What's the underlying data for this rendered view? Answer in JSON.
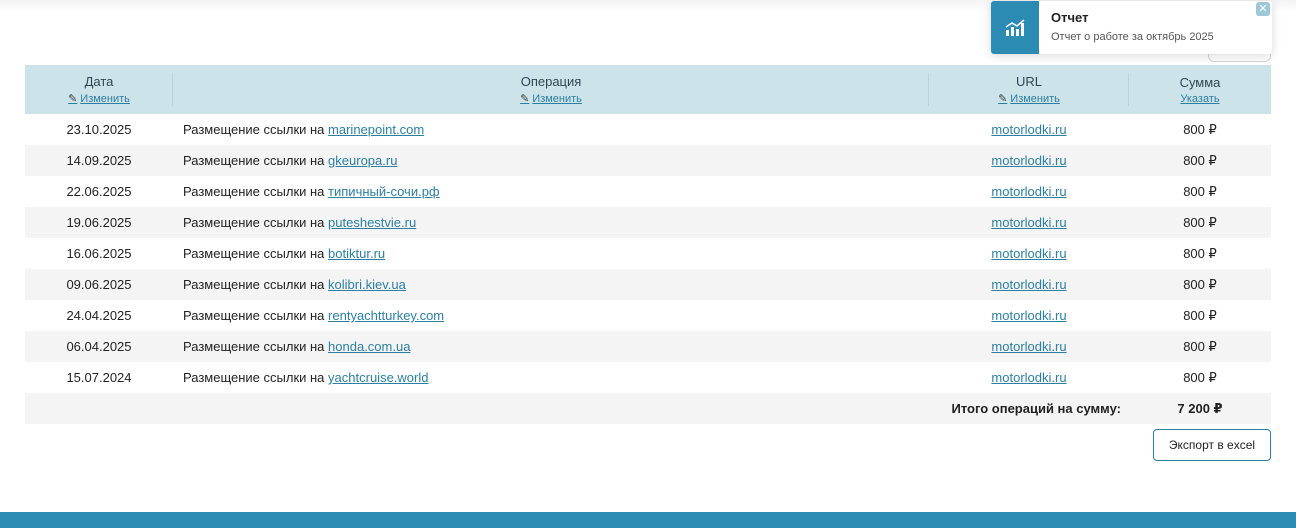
{
  "notification": {
    "title": "Отчет",
    "text": "Отчет о работе за октябрь 2025",
    "close": "✕"
  },
  "table": {
    "headers": {
      "date": "Дата",
      "operation": "Операция",
      "url": "URL",
      "sum": "Сумма",
      "date_edit": "Изменить",
      "operation_edit": "Изменить",
      "url_edit": "Изменить",
      "sum_edit": "Указать"
    },
    "op_prefix": "Размещение ссылки на",
    "rows": [
      {
        "date": "23.10.2025",
        "site": "marinepoint.com",
        "url": "motorlodki.ru",
        "sum": "800 ₽"
      },
      {
        "date": "14.09.2025",
        "site": "gkeuropa.ru",
        "url": "motorlodki.ru",
        "sum": "800 ₽"
      },
      {
        "date": "22.06.2025",
        "site": "типичный-сочи.рф",
        "url": "motorlodki.ru",
        "sum": "800 ₽"
      },
      {
        "date": "19.06.2025",
        "site": "puteshestvie.ru",
        "url": "motorlodki.ru",
        "sum": "800 ₽"
      },
      {
        "date": "16.06.2025",
        "site": "botiktur.ru",
        "url": "motorlodki.ru",
        "sum": "800 ₽"
      },
      {
        "date": "09.06.2025",
        "site": "kolibri.kiev.ua",
        "url": "motorlodki.ru",
        "sum": "800 ₽"
      },
      {
        "date": "24.04.2025",
        "site": "rentyachtturkey.com",
        "url": "motorlodki.ru",
        "sum": "800 ₽"
      },
      {
        "date": "06.04.2025",
        "site": "honda.com.ua",
        "url": "motorlodki.ru",
        "sum": "800 ₽"
      },
      {
        "date": "15.07.2024",
        "site": "yachtcruise.world",
        "url": "motorlodki.ru",
        "sum": "800 ₽"
      }
    ],
    "total_label": "Итого операций на сумму:",
    "total_value": "7 200 ₽"
  },
  "export_label": "Экспорт в excel",
  "colors": {
    "accent": "#2c8bb2",
    "header_bg": "#cde3ea",
    "link": "#2c7fa0"
  }
}
